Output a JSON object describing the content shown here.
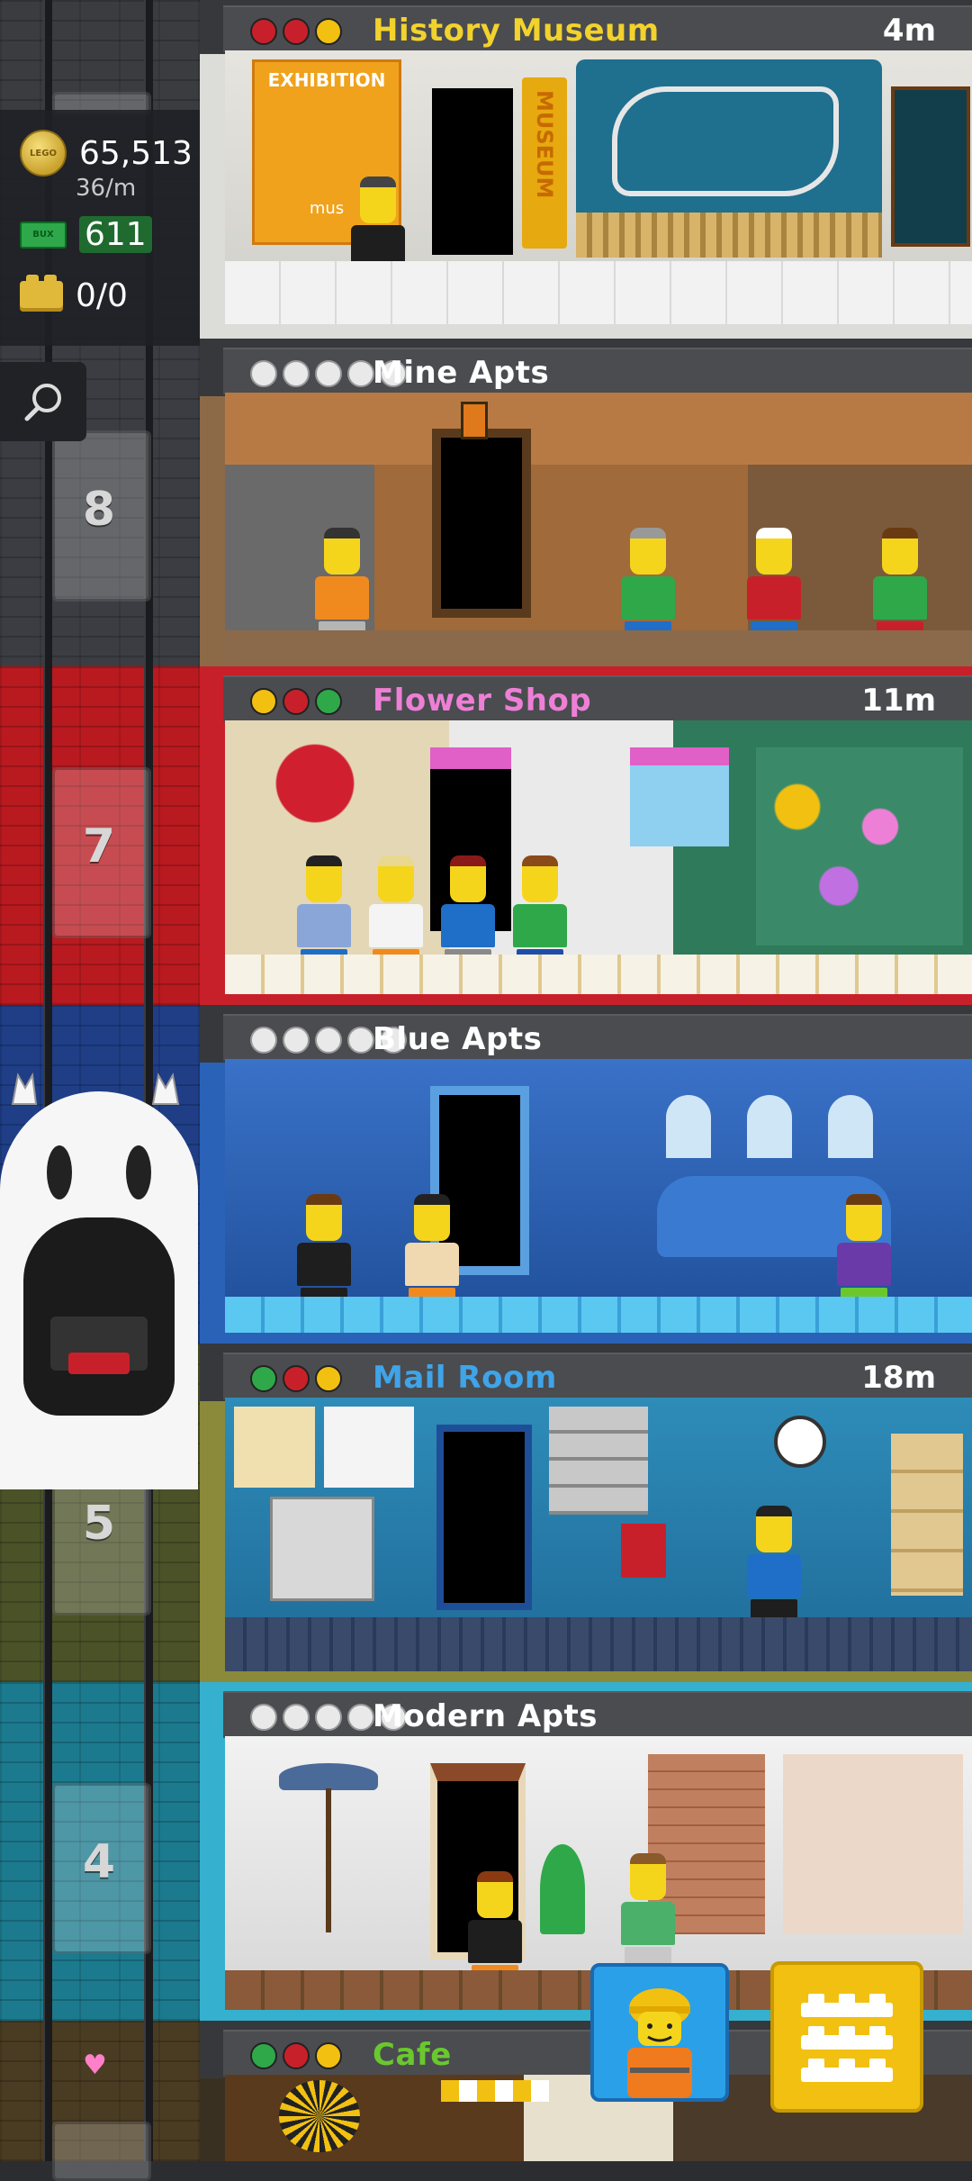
{
  "hud": {
    "coins": "65,513",
    "rate": "36/m",
    "bux": "611",
    "bricks": "0/0",
    "coin_icon_text": "LEGO",
    "bux_icon_text": "BUX"
  },
  "shaft": {
    "floor_numbers": [
      "8",
      "7",
      "5",
      "4"
    ]
  },
  "floors": [
    {
      "name": "History Museum",
      "timer": "4m",
      "color": "#f2d22c",
      "type": "business",
      "stars": [
        "#c8202a",
        "#c8202a",
        "#f2c011"
      ]
    },
    {
      "name": "Mine Apts",
      "timer": "",
      "color": "#ffffff",
      "type": "residential",
      "stars": [
        "#e9e9e9",
        "#e9e9e9",
        "#e9e9e9",
        "#e9e9e9",
        "#e9e9e9"
      ]
    },
    {
      "name": "Flower Shop",
      "timer": "11m",
      "color": "#ee7fd6",
      "type": "business",
      "stars": [
        "#f2c011",
        "#c8202a",
        "#2fa84a"
      ]
    },
    {
      "name": "Blue Apts",
      "timer": "",
      "color": "#ffffff",
      "type": "residential",
      "stars": [
        "#e9e9e9",
        "#e9e9e9",
        "#e9e9e9",
        "#e9e9e9",
        "#e9e9e9"
      ]
    },
    {
      "name": "Mail Room",
      "timer": "18m",
      "color": "#3fa4e8",
      "type": "business",
      "stars": [
        "#2fa84a",
        "#c8202a",
        "#f2c011"
      ]
    },
    {
      "name": "Modern Apts",
      "timer": "",
      "color": "#ffffff",
      "type": "residential",
      "stars": [
        "#e9e9e9",
        "#e9e9e9",
        "#e9e9e9",
        "#e9e9e9",
        "#e9e9e9"
      ]
    },
    {
      "name": "Cafe",
      "timer": "",
      "color": "#6ac82e",
      "type": "business",
      "stars": [
        "#2fa84a",
        "#c8202a",
        "#f2c011"
      ]
    }
  ],
  "scene_labels": {
    "exhibition": "EXHIBITION",
    "museum_sign": "MUSEUM",
    "museum_poster": "mus"
  },
  "icons": {
    "search": "search-icon",
    "heart": "heart-icon",
    "menu": "brick-menu-icon",
    "worker": "construction-worker-icon"
  }
}
